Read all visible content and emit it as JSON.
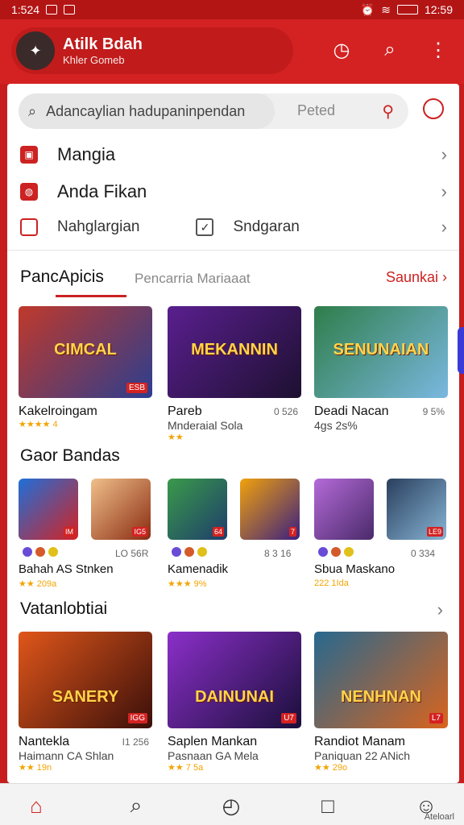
{
  "status": {
    "time_left": "1:524",
    "time_right": "12:59"
  },
  "header": {
    "title": "Atilk Bdah",
    "subtitle": "Khler Gomeb"
  },
  "search": {
    "placeholder": "Adancaylian  hadupaninpendan",
    "peted": "Peted"
  },
  "menu": [
    {
      "label": "Mangia"
    },
    {
      "label": "Anda Fikan"
    },
    {
      "label": "Nahglargian",
      "extra": "Sndgaran"
    }
  ],
  "tabs": {
    "active": "PancApicis",
    "inactive": "Pencarria Mariaaat",
    "link": "Saunkai"
  },
  "top_games": [
    {
      "title": "CIMCAL",
      "name": "Kakelroingam",
      "meta": "",
      "sub": "",
      "rating": "★★★★ 4",
      "badge": "ESB",
      "colors": [
        "#c0392b",
        "#2c3e8f"
      ]
    },
    {
      "title": "MEKANNIN",
      "name": "Pareb",
      "meta": "0 526",
      "sub": "Mnderaial Sola",
      "rating": "★★",
      "badge": "",
      "colors": [
        "#5a1f8f",
        "#1d1030"
      ]
    },
    {
      "title": "SENUNAIAN",
      "name": "Deadi Nacan",
      "meta": "9 5%",
      "sub": "4gs 2s%",
      "rating": "",
      "badge": "",
      "colors": [
        "#2f7d4a",
        "#7ab8e0"
      ]
    }
  ],
  "section2": {
    "title": "Gaor Bandas"
  },
  "group_games": [
    {
      "name": "Bahah AS Stnken",
      "meta": "LO 56R",
      "rating": "★★ 209a",
      "thumbs": [
        {
          "colors": [
            "#1e6fd9",
            "#d42222"
          ],
          "badge": "IM"
        },
        {
          "colors": [
            "#f0c08a",
            "#8a2b12"
          ],
          "badge": "IG5"
        }
      ]
    },
    {
      "name": "Kamenadik",
      "meta": "8 3 16",
      "rating": "★★★ 9%",
      "thumbs": [
        {
          "colors": [
            "#3a9a4a",
            "#1e3d6b"
          ],
          "badge": "64"
        },
        {
          "colors": [
            "#f1a10c",
            "#3a1f80"
          ],
          "badge": "7"
        }
      ]
    },
    {
      "name": "Sbua Maskano",
      "meta": "0 334",
      "rating": "222 1Ida",
      "thumbs": [
        {
          "colors": [
            "#b46ad8",
            "#4a2a6a"
          ],
          "badge": ""
        },
        {
          "colors": [
            "#2a3f5e",
            "#87b4d4"
          ],
          "badge": "LE9"
        }
      ]
    }
  ],
  "section3": {
    "title": "Vatanlobtiai"
  },
  "bottom_games": [
    {
      "title": "SANERY",
      "name": "Nantekla",
      "meta": "I1 256",
      "sub": "Haimann CA Shlan",
      "rating": "★★ 19n",
      "badge": "IGG",
      "colors": [
        "#e0561a",
        "#3a0f0a"
      ]
    },
    {
      "title": "DAINUNAI",
      "name": "Saplen Mankan",
      "meta": "",
      "sub": "Pasnaan GA Mela",
      "rating": "★★ 7 5a",
      "badge": "U7",
      "colors": [
        "#8b2fc9",
        "#1a0f3a"
      ]
    },
    {
      "title": "NENHNAN",
      "name": "Randiot Manam",
      "meta": "",
      "sub": "Paniquan 22 ANich",
      "rating": "★★ 29o",
      "badge": "L7",
      "colors": [
        "#27688f",
        "#d9641e"
      ]
    }
  ],
  "bottomnav": {
    "last_label": "Ateloarl"
  }
}
